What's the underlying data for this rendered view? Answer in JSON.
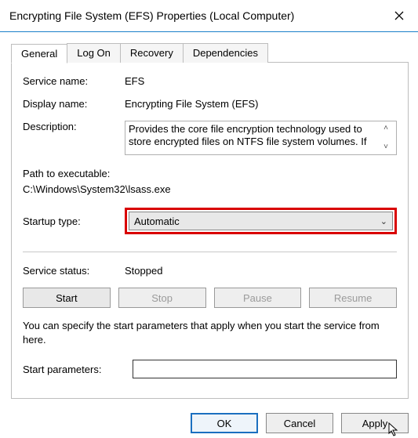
{
  "titlebar": {
    "title": "Encrypting File System (EFS) Properties (Local Computer)"
  },
  "tabs": {
    "general": "General",
    "logon": "Log On",
    "recovery": "Recovery",
    "dependencies": "Dependencies"
  },
  "general": {
    "service_name_label": "Service name:",
    "service_name": "EFS",
    "display_name_label": "Display name:",
    "display_name": "Encrypting File System (EFS)",
    "description_label": "Description:",
    "description": "Provides the core file encryption technology used to store encrypted files on NTFS file system volumes. If",
    "path_label": "Path to executable:",
    "path": "C:\\Windows\\System32\\lsass.exe",
    "startup_label": "Startup type:",
    "startup_value": "Automatic",
    "status_label": "Service status:",
    "status_value": "Stopped",
    "buttons": {
      "start": "Start",
      "stop": "Stop",
      "pause": "Pause",
      "resume": "Resume"
    },
    "note": "You can specify the start parameters that apply when you start the service from here.",
    "params_label": "Start parameters:",
    "params_value": ""
  },
  "footer": {
    "ok": "OK",
    "cancel": "Cancel",
    "apply": "Apply"
  }
}
